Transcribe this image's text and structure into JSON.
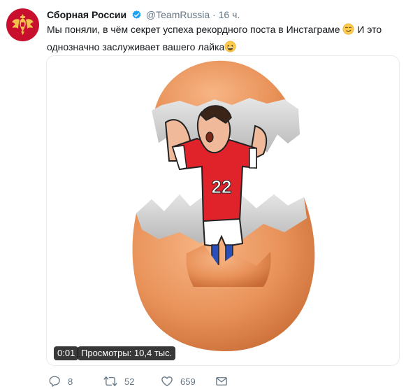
{
  "tweet": {
    "author_name": "Сборная России",
    "handle": "@TeamRussia",
    "separator": "·",
    "time": "16 ч.",
    "text_part1": "Мы поняли, в чём секрет успеха рекордного поста в Инстаграме",
    "text_part2": " И это однозначно заслуживает вашего лайка",
    "emoji_1": "smirk-emoji",
    "emoji_2": "grinning-emoji",
    "player_number": "22"
  },
  "video": {
    "duration": "0:01",
    "views": "Просмотры: 10,4 тыс."
  },
  "actions": {
    "replies": "8",
    "retweets": "52",
    "likes": "659"
  },
  "colors": {
    "avatar_bg": "#c8102e",
    "verified": "#1da1f2",
    "muted": "#657786",
    "egg": "#e9935a",
    "jersey": "#e0222b"
  }
}
